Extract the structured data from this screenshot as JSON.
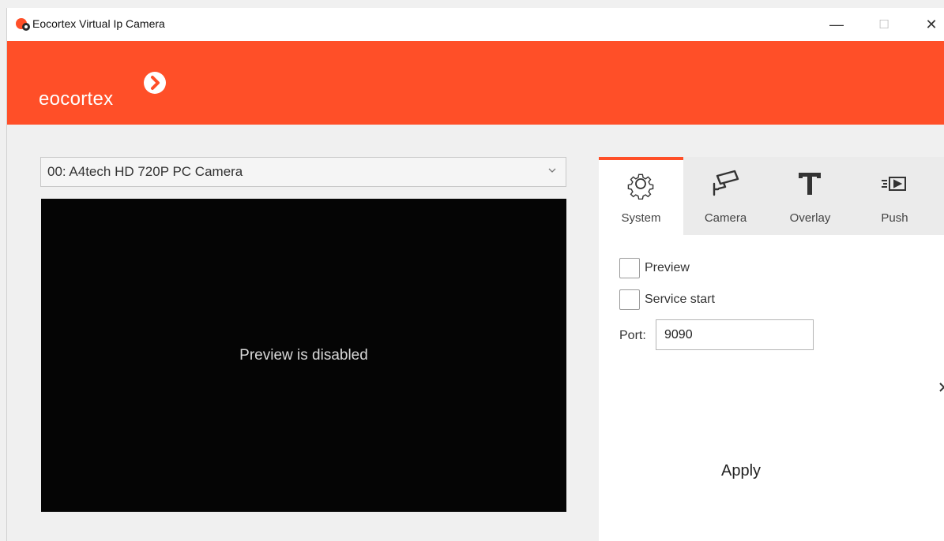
{
  "window": {
    "title": "Eocortex Virtual Ip Camera",
    "controls": {
      "minimize": "—",
      "maximize": "☐",
      "close": "✕"
    }
  },
  "brand": {
    "logo_text": "eocortex",
    "color": "#ff4f28"
  },
  "camera_select": {
    "selected": "00: A4tech HD 720P PC Camera"
  },
  "preview": {
    "message": "Preview is disabled"
  },
  "tabs": [
    {
      "label": "System",
      "icon": "gear-icon",
      "active": true
    },
    {
      "label": "Camera",
      "icon": "cctv-camera-icon",
      "active": false
    },
    {
      "label": "Overlay",
      "icon": "text-overlay-icon",
      "active": false
    },
    {
      "label": "Push",
      "icon": "push-stream-icon",
      "active": false
    }
  ],
  "system": {
    "preview_label": "Preview",
    "preview_checked": false,
    "service_start_label": "Service start",
    "service_start_checked": false,
    "port_label": "Port:",
    "port_value": "9090",
    "apply_label": "Apply"
  },
  "colors": {
    "accent": "#ff4f28",
    "preview_background": "#050505"
  }
}
